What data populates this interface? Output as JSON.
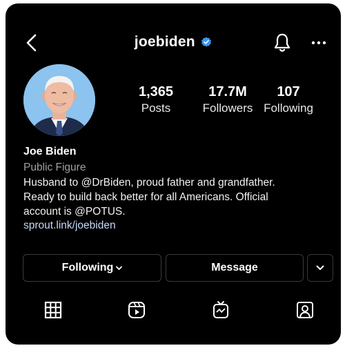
{
  "header": {
    "username": "joebiden",
    "back_icon": "chevron-left-icon",
    "verified_icon": "verified-badge-icon",
    "bell_icon": "bell-icon",
    "more_icon": "more-dots-icon"
  },
  "stats": [
    {
      "value": "1,365",
      "label": "Posts"
    },
    {
      "value": "17.7M",
      "label": "Followers"
    },
    {
      "value": "107",
      "label": "Following"
    }
  ],
  "profile": {
    "name": "Joe Biden",
    "category": "Public Figure",
    "bio_lines": [
      "Husband to @DrBiden, proud father and grandfather.",
      "Ready to build back better for all Americans. Official",
      "account is @POTUS."
    ],
    "link": "sprout.link/joebiden"
  },
  "actions": {
    "following_label": "Following",
    "message_label": "Message"
  },
  "tabs": [
    {
      "icon": "grid-icon"
    },
    {
      "icon": "reels-icon"
    },
    {
      "icon": "igtv-icon"
    },
    {
      "icon": "tagged-icon"
    }
  ],
  "colors": {
    "background": "#000000",
    "verified": "#3897f0",
    "link": "#c7d9f7",
    "secondary_text": "#a0a0a0",
    "button_border": "#3a3a3a"
  }
}
